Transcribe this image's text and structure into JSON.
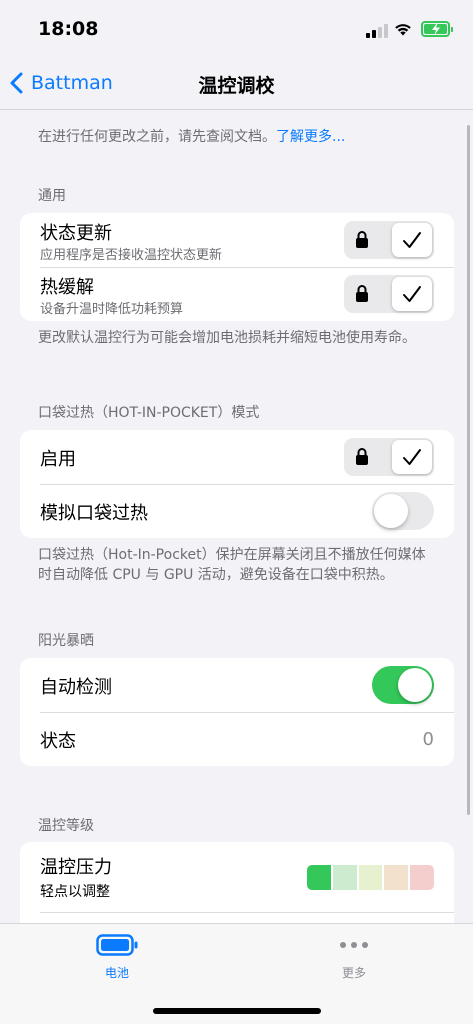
{
  "status_bar": {
    "time": "18:08",
    "signal_icon": "cellular-signal-icon",
    "wifi_icon": "wifi-icon",
    "battery_icon": "battery-charging-icon"
  },
  "nav": {
    "back_label": "Battman",
    "back_icon": "chevron-left-icon",
    "title": "温控调校"
  },
  "intro": {
    "text": "在进行任何更改之前，请先查阅文档。",
    "link": "了解更多..."
  },
  "sections": {
    "general": {
      "header": "通用",
      "rows": [
        {
          "title": "状态更新",
          "subtitle": "应用程序是否接收温控状态更新",
          "locked": true,
          "checked": true
        },
        {
          "title": "热缓解",
          "subtitle": "设备升温时降低功耗预算",
          "locked": true,
          "checked": true
        }
      ],
      "footer": "更改默认温控行为可能会增加电池损耗并缩短电池使用寿命。"
    },
    "hip": {
      "header": "口袋过热（HOT-IN-POCKET）模式",
      "rows": [
        {
          "title": "启用",
          "locked": true,
          "checked": true
        },
        {
          "title": "模拟口袋过热",
          "toggle": false
        }
      ],
      "footer": "口袋过热（Hot-In-Pocket）保护在屏幕关闭且不播放任何媒体时自动降低 CPU 与 GPU 活动，避免设备在口袋中积热。"
    },
    "sun": {
      "header": "阳光暴晒",
      "rows": [
        {
          "title": "自动检测",
          "toggle": true
        },
        {
          "title": "状态",
          "value": "0"
        }
      ]
    },
    "thermal_level": {
      "header": "温控等级",
      "rows": [
        {
          "title": "温控压力",
          "subtitle": "轻点以调整",
          "scale_colors": [
            "#34c759",
            "#cdeccf",
            "#e6f2cf",
            "#f2e2cd",
            "#f4cdcd"
          ],
          "level": 0
        }
      ]
    }
  },
  "tab_bar": {
    "tabs": [
      {
        "label": "电池",
        "icon": "battery-icon",
        "active": true
      },
      {
        "label": "更多",
        "icon": "more-dots-icon",
        "active": false
      }
    ]
  },
  "colors": {
    "accent": "#0a7aff",
    "toggle_on": "#34c759",
    "background": "#f2f2f7"
  }
}
